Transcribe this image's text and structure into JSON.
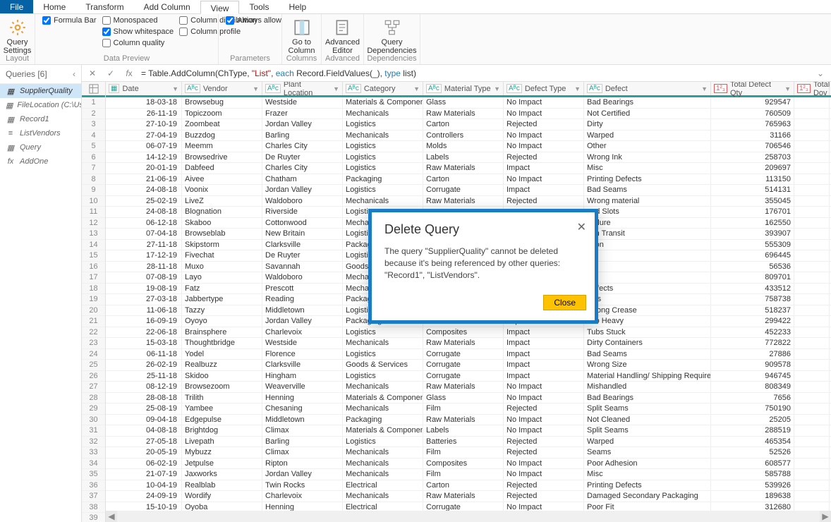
{
  "menu": {
    "file": "File",
    "home": "Home",
    "transform": "Transform",
    "add_column": "Add Column",
    "view": "View",
    "tools": "Tools",
    "help": "Help"
  },
  "ribbon": {
    "query_settings": "Query\nSettings",
    "layout": "Layout",
    "formula_bar": "Formula Bar",
    "monospaced": "Monospaced",
    "show_whitespace": "Show whitespace",
    "column_quality": "Column quality",
    "column_distribution": "Column distribution",
    "column_profile": "Column profile",
    "data_preview": "Data Preview",
    "always_allow": "Always allow",
    "go_to_column": "Go to\nColumn",
    "columns": "Columns",
    "parameters": "Parameters",
    "advanced_editor": "Advanced\nEditor",
    "advanced": "Advanced",
    "query_dependencies": "Query\nDependencies",
    "dependencies": "Dependencies"
  },
  "queries": {
    "header": "Queries [6]",
    "items": [
      {
        "label": "SupplierQuality"
      },
      {
        "label": "FileLocation (C:\\Users..."
      },
      {
        "label": "Record1"
      },
      {
        "label": "ListVendors"
      },
      {
        "label": "Query"
      },
      {
        "label": "AddOne"
      }
    ]
  },
  "formula": {
    "prefix": "= Table.AddColumn(ChType, ",
    "str1": "\"List\"",
    "mid": ", ",
    "kw1": "each",
    "mid2": " Record.FieldValues(_), ",
    "kw2": "type",
    "mid3": " list)"
  },
  "columns": [
    {
      "key": "date",
      "label": "Date",
      "type": "date",
      "cls": "c-date"
    },
    {
      "key": "vendor",
      "label": "Vendor",
      "type": "text",
      "cls": "c-vendor"
    },
    {
      "key": "plant",
      "label": "Plant Location",
      "type": "text",
      "cls": "c-plant"
    },
    {
      "key": "category",
      "label": "Category",
      "type": "text",
      "cls": "c-category"
    },
    {
      "key": "material",
      "label": "Material Type",
      "type": "text",
      "cls": "c-material"
    },
    {
      "key": "defecttype",
      "label": "Defect Type",
      "type": "text",
      "cls": "c-defecttype"
    },
    {
      "key": "defect",
      "label": "Defect",
      "type": "text",
      "cls": "c-defect"
    },
    {
      "key": "qty",
      "label": "Total Defect Qty",
      "type": "num",
      "cls": "c-qty"
    },
    {
      "key": "downtime",
      "label": "Total Dov",
      "type": "num",
      "cls": "c-downtime"
    }
  ],
  "rows": [
    {
      "date": "18-03-18",
      "vendor": "Browsebug",
      "plant": "Westside",
      "category": "Materials & Components",
      "material": "Glass",
      "defecttype": "No Impact",
      "defect": "Bad Bearings",
      "qty": "929547"
    },
    {
      "date": "26-11-19",
      "vendor": "Topiczoom",
      "plant": "Frazer",
      "category": "Mechanicals",
      "material": "Raw Materials",
      "defecttype": "No Impact",
      "defect": "Not Certified",
      "qty": "760509"
    },
    {
      "date": "27-10-19",
      "vendor": "Zoombeat",
      "plant": "Jordan Valley",
      "category": "Logistics",
      "material": "Carton",
      "defecttype": "Rejected",
      "defect": "Dirty",
      "qty": "765963"
    },
    {
      "date": "27-04-19",
      "vendor": "Buzzdog",
      "plant": "Barling",
      "category": "Mechanicals",
      "material": "Controllers",
      "defecttype": "No Impact",
      "defect": "Warped",
      "qty": "31166"
    },
    {
      "date": "06-07-19",
      "vendor": "Meemm",
      "plant": "Charles City",
      "category": "Logistics",
      "material": "Molds",
      "defecttype": "No Impact",
      "defect": "Other",
      "qty": "706546"
    },
    {
      "date": "14-12-19",
      "vendor": "Browsedrive",
      "plant": "De Ruyter",
      "category": "Logistics",
      "material": "Labels",
      "defecttype": "Rejected",
      "defect": "Wrong Ink",
      "qty": "258703"
    },
    {
      "date": "20-01-19",
      "vendor": "Dabfeed",
      "plant": "Charles City",
      "category": "Logistics",
      "material": "Raw Materials",
      "defecttype": "Impact",
      "defect": "Misc",
      "qty": "209697"
    },
    {
      "date": "21-06-19",
      "vendor": "Aivee",
      "plant": "Chatham",
      "category": "Packaging",
      "material": "Carton",
      "defecttype": "No Impact",
      "defect": "Printing Defects",
      "qty": "113150"
    },
    {
      "date": "24-08-18",
      "vendor": "Voonix",
      "plant": "Jordan Valley",
      "category": "Logistics",
      "material": "Corrugate",
      "defecttype": "Impact",
      "defect": "Bad Seams",
      "qty": "514131"
    },
    {
      "date": "25-02-19",
      "vendor": "LiveZ",
      "plant": "Waldoboro",
      "category": "Mechanicals",
      "material": "Raw Materials",
      "defecttype": "Rejected",
      "defect": "Wrong material",
      "qty": "355045"
    },
    {
      "date": "24-08-18",
      "vendor": "Blognation",
      "plant": "Riverside",
      "category": "Logistics",
      "material": "",
      "defecttype": "",
      "defect": "ned Slots",
      "qty": "176701"
    },
    {
      "date": "06-12-18",
      "vendor": "Skaboo",
      "plant": "Cottonwood",
      "category": "Mechanic",
      "material": "",
      "defecttype": "",
      "defect": "Failure",
      "qty": "162550"
    },
    {
      "date": "07-04-18",
      "vendor": "Browseblab",
      "plant": "New Britain",
      "category": "Logistics",
      "material": "",
      "defecttype": "",
      "defect": "d in Transit",
      "qty": "393907"
    },
    {
      "date": "27-11-18",
      "vendor": "Skipstorm",
      "plant": "Clarksville",
      "category": "Packaging",
      "material": "",
      "defecttype": "",
      "defect": "ation",
      "qty": "555309"
    },
    {
      "date": "17-12-19",
      "vendor": "Fivechat",
      "plant": "De Ruyter",
      "category": "Logistics",
      "material": "",
      "defecttype": "",
      "defect": "ck",
      "qty": "696445"
    },
    {
      "date": "28-11-18",
      "vendor": "Muxo",
      "plant": "Savannah",
      "category": "Goods & S",
      "material": "",
      "defecttype": "",
      "defect": "ms",
      "qty": "56536"
    },
    {
      "date": "07-08-19",
      "vendor": "Layo",
      "plant": "Waldoboro",
      "category": "Mechanic",
      "material": "",
      "defecttype": "",
      "defect": "",
      "qty": "809701"
    },
    {
      "date": "19-08-19",
      "vendor": "Fatz",
      "plant": "Prescott",
      "category": "Mechanic",
      "material": "",
      "defecttype": "",
      "defect": "Defects",
      "qty": "433512"
    },
    {
      "date": "27-03-18",
      "vendor": "Jabbertype",
      "plant": "Reading",
      "category": "Packaging",
      "material": "",
      "defecttype": "",
      "defect": "ects",
      "qty": "758738"
    },
    {
      "date": "11-06-18",
      "vendor": "Tazzy",
      "plant": "Middletown",
      "category": "Logistics",
      "material": "Corrugate",
      "defecttype": "Impact",
      "defect": "Wrong Crease",
      "qty": "518237"
    },
    {
      "date": "16-09-19",
      "vendor": "Oyoyo",
      "plant": "Jordan Valley",
      "category": "Packaging",
      "material": "Carton",
      "defecttype": "Impact",
      "defect": "Too Heavy",
      "qty": "299422"
    },
    {
      "date": "22-06-18",
      "vendor": "Brainsphere",
      "plant": "Charlevoix",
      "category": "Logistics",
      "material": "Composites",
      "defecttype": "Impact",
      "defect": "Tubs Stuck",
      "qty": "452233"
    },
    {
      "date": "15-03-18",
      "vendor": "Thoughtbridge",
      "plant": "Westside",
      "category": "Mechanicals",
      "material": "Raw Materials",
      "defecttype": "Impact",
      "defect": "Dirty Containers",
      "qty": "772822"
    },
    {
      "date": "06-11-18",
      "vendor": "Yodel",
      "plant": "Florence",
      "category": "Logistics",
      "material": "Corrugate",
      "defecttype": "Impact",
      "defect": "Bad Seams",
      "qty": "27886"
    },
    {
      "date": "26-02-19",
      "vendor": "Realbuzz",
      "plant": "Clarksville",
      "category": "Goods & Services",
      "material": "Corrugate",
      "defecttype": "Impact",
      "defect": "Wrong  Size",
      "qty": "909578"
    },
    {
      "date": "25-11-18",
      "vendor": "Skidoo",
      "plant": "Hingham",
      "category": "Logistics",
      "material": "Corrugate",
      "defecttype": "Impact",
      "defect": "Material Handling/ Shipping Requirements Error",
      "qty": "946745"
    },
    {
      "date": "08-12-19",
      "vendor": "Browsezoom",
      "plant": "Weaverville",
      "category": "Mechanicals",
      "material": "Raw Materials",
      "defecttype": "No Impact",
      "defect": "Mishandled",
      "qty": "808349"
    },
    {
      "date": "28-08-18",
      "vendor": "Trilith",
      "plant": "Henning",
      "category": "Materials & Components",
      "material": "Glass",
      "defecttype": "No Impact",
      "defect": "Bad Bearings",
      "qty": "7656"
    },
    {
      "date": "25-08-19",
      "vendor": "Yambee",
      "plant": "Chesaning",
      "category": "Mechanicals",
      "material": "Film",
      "defecttype": "Rejected",
      "defect": "Split Seams",
      "qty": "750190"
    },
    {
      "date": "09-04-18",
      "vendor": "Edgepulse",
      "plant": "Middletown",
      "category": "Packaging",
      "material": "Raw Materials",
      "defecttype": "No Impact",
      "defect": "Not Cleaned",
      "qty": "25205"
    },
    {
      "date": "04-08-18",
      "vendor": "Brightdog",
      "plant": "Climax",
      "category": "Materials & Components",
      "material": "Labels",
      "defecttype": "No Impact",
      "defect": "Split Seams",
      "qty": "288519"
    },
    {
      "date": "27-05-18",
      "vendor": "Livepath",
      "plant": "Barling",
      "category": "Logistics",
      "material": "Batteries",
      "defecttype": "Rejected",
      "defect": "Warped",
      "qty": "465354"
    },
    {
      "date": "20-05-19",
      "vendor": "Mybuzz",
      "plant": "Climax",
      "category": "Mechanicals",
      "material": "Film",
      "defecttype": "Rejected",
      "defect": "Seams",
      "qty": "52526"
    },
    {
      "date": "06-02-19",
      "vendor": "Jetpulse",
      "plant": "Ripton",
      "category": "Mechanicals",
      "material": "Composites",
      "defecttype": "No Impact",
      "defect": "Poor  Adhesion",
      "qty": "608577"
    },
    {
      "date": "21-07-19",
      "vendor": "Jaxworks",
      "plant": "Jordan Valley",
      "category": "Mechanicals",
      "material": "Film",
      "defecttype": "No Impact",
      "defect": "Misc",
      "qty": "585788"
    },
    {
      "date": "10-04-19",
      "vendor": "Realblab",
      "plant": "Twin Rocks",
      "category": "Electrical",
      "material": "Carton",
      "defecttype": "Rejected",
      "defect": "Printing Defects",
      "qty": "539926"
    },
    {
      "date": "24-09-19",
      "vendor": "Wordify",
      "plant": "Charlevoix",
      "category": "Mechanicals",
      "material": "Raw Materials",
      "defecttype": "Rejected",
      "defect": "Damaged Secondary Packaging",
      "qty": "189638"
    },
    {
      "date": "15-10-19",
      "vendor": "Oyoba",
      "plant": "Henning",
      "category": "Electrical",
      "material": "Corrugate",
      "defecttype": "No Impact",
      "defect": "Poor Fit",
      "qty": "312680"
    }
  ],
  "extra_rownum": "39",
  "dialog": {
    "title": "Delete Query",
    "body": "The query \"SupplierQuality\" cannot be deleted because it's being referenced by other queries: \"Record1\", \"ListVendors\".",
    "close": "Close"
  }
}
